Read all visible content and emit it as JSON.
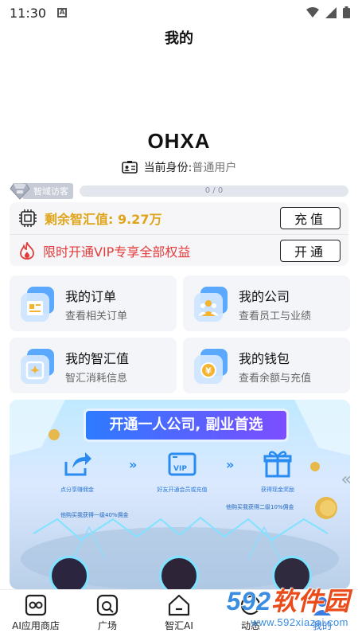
{
  "status_bar": {
    "time": "11:30",
    "notification_letter": "A"
  },
  "header": {
    "title": "我的"
  },
  "profile": {
    "username": "OHXA",
    "identity_label": "当前身份:",
    "identity_value": "普通用户"
  },
  "level": {
    "name": "智域访客",
    "progress_text": "0 / 0",
    "progress_fraction": 0
  },
  "benefits": {
    "balance_text": "剩余智汇值: 9.27万",
    "recharge_button": "充值",
    "vip_text": "限时开通VIP专享全部权益",
    "open_button": "开通",
    "colors": {
      "balance": "#e0a419",
      "vip": "#e23b3b"
    }
  },
  "tiles": [
    {
      "title": "我的订单",
      "subtitle": "查看相关订单",
      "icon": "order-icon"
    },
    {
      "title": "我的公司",
      "subtitle": "查看员工与业绩",
      "icon": "company-icon"
    },
    {
      "title": "我的智汇值",
      "subtitle": "智汇消耗信息",
      "icon": "points-icon"
    },
    {
      "title": "我的钱包",
      "subtitle": "查看余额与充值",
      "icon": "wallet-icon"
    }
  ],
  "banner": {
    "title": "开通一人公司, 副业首选",
    "steps": [
      {
        "caption": "点分享赚佣金",
        "icon": "share-icon"
      },
      {
        "caption": "好友开通会员或充值",
        "icon": "vip-card-icon"
      },
      {
        "caption": "获得现金奖励",
        "icon": "gift-icon"
      }
    ],
    "vip_badge": "VIP",
    "tier_left": "他购买我获得一级40%佣金",
    "tier_right": "他购买我获得二级10%佣金"
  },
  "bottom_nav": [
    {
      "label": "AI应用商店",
      "icon": "ai-store-icon"
    },
    {
      "label": "广场",
      "icon": "square-icon"
    },
    {
      "label": "智汇AI",
      "icon": "home-ai-icon"
    },
    {
      "label": "动态",
      "icon": "feed-icon"
    },
    {
      "label": "我的",
      "icon": "profile-icon"
    }
  ],
  "watermark": {
    "text_digits": "592",
    "text_cn": "软件园",
    "url": "www.592xiazai.com"
  },
  "accent_color": "#3a7be0"
}
